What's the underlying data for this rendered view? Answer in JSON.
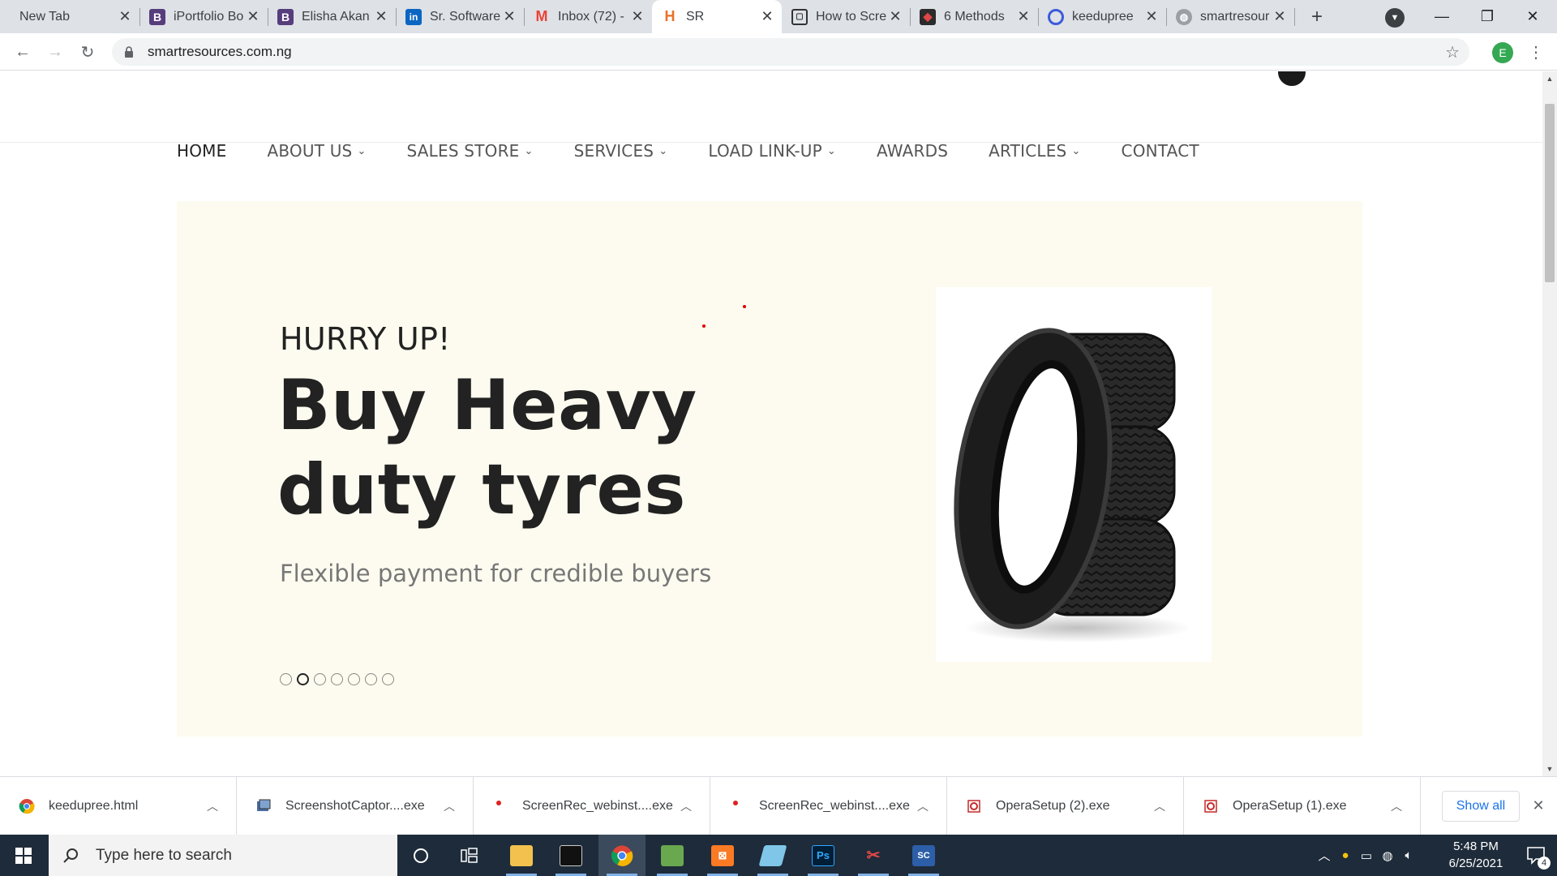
{
  "browser": {
    "tabs": [
      {
        "title": "New Tab",
        "icon": "none",
        "active": false
      },
      {
        "title": "iPortfolio Bo",
        "icon": "bootstrap-icon",
        "active": false
      },
      {
        "title": "Elisha Akan",
        "icon": "bootstrap-icon",
        "active": false
      },
      {
        "title": "Sr. Software",
        "icon": "linkedin-icon",
        "active": false
      },
      {
        "title": "Inbox (72) -",
        "icon": "gmail-icon",
        "active": false
      },
      {
        "title": "SR",
        "icon": "site-h-icon",
        "active": true
      },
      {
        "title": "How to Scre",
        "icon": "screen-icon",
        "active": false
      },
      {
        "title": "6 Methods",
        "icon": "site-icon",
        "active": false
      },
      {
        "title": "keedupree",
        "icon": "ring-icon",
        "active": false
      },
      {
        "title": "smartresour",
        "icon": "globe-icon",
        "active": false
      }
    ],
    "url": "smartresources.com.ng",
    "profile_initial": "E"
  },
  "site": {
    "nav": [
      {
        "label": "HOME",
        "dropdown": false,
        "active": true
      },
      {
        "label": "ABOUT US",
        "dropdown": true
      },
      {
        "label": "SALES STORE",
        "dropdown": true
      },
      {
        "label": "SERVICES",
        "dropdown": true
      },
      {
        "label": "LOAD LINK-UP",
        "dropdown": true
      },
      {
        "label": "AWARDS",
        "dropdown": false
      },
      {
        "label": "ARTICLES",
        "dropdown": true
      },
      {
        "label": "CONTACT",
        "dropdown": false
      }
    ],
    "hero": {
      "kicker": "HURRY UP!",
      "title": "Buy Heavy duty tyres",
      "subtitle": "Flexible payment for credible buyers",
      "slide_count": 7,
      "active_slide": 2,
      "background": "#fdfbef"
    }
  },
  "downloads": {
    "items": [
      {
        "name": "keedupree.html",
        "icon": "chrome-icon"
      },
      {
        "name": "ScreenshotCaptor....exe",
        "icon": "installer-icon"
      },
      {
        "name": "ScreenRec_webinst....exe",
        "icon": "screenrec-icon"
      },
      {
        "name": "ScreenRec_webinst....exe",
        "icon": "screenrec-icon"
      },
      {
        "name": "OperaSetup (2).exe",
        "icon": "opera-setup-icon"
      },
      {
        "name": "OperaSetup (1).exe",
        "icon": "opera-setup-icon"
      }
    ],
    "show_all_label": "Show all"
  },
  "taskbar": {
    "search_placeholder": "Type here to search",
    "time": "5:48 PM",
    "date": "6/25/2021",
    "notification_count": "4"
  }
}
